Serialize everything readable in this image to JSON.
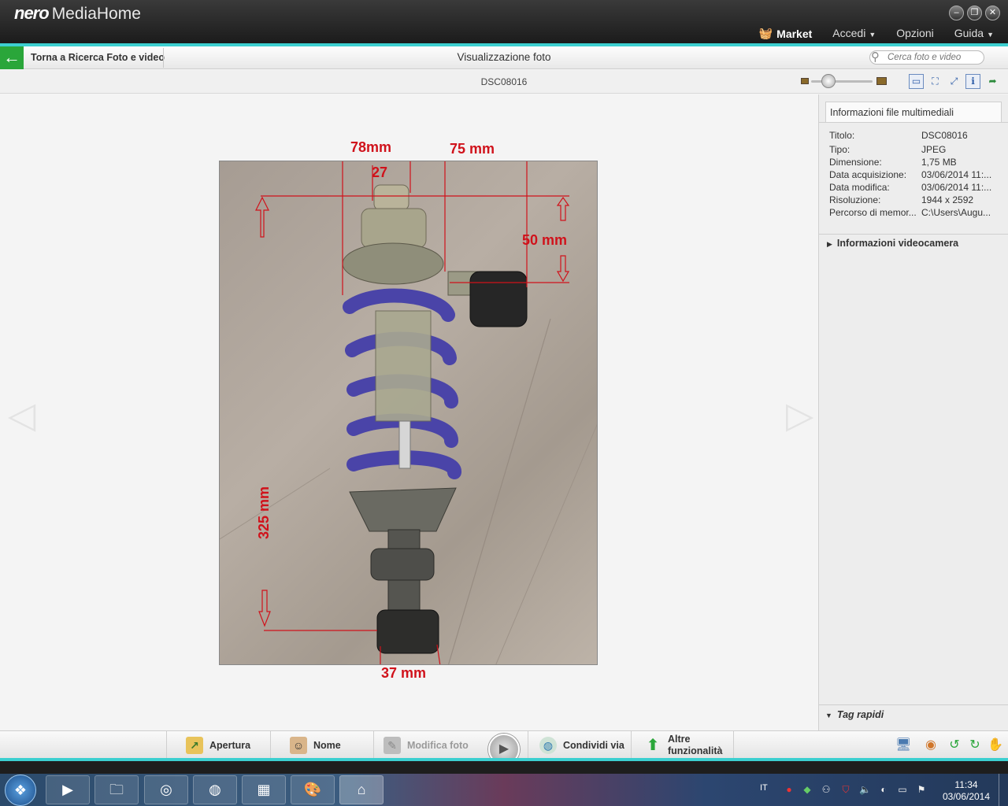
{
  "window": {
    "brand_logo": "nero",
    "brand_name": "MediaHome",
    "controls": {
      "minimize": "–",
      "restore": "❐",
      "close": "✕"
    }
  },
  "top_menu": {
    "market": "Market",
    "accedi": "Accedi",
    "opzioni": "Opzioni",
    "guida": "Guida"
  },
  "nav": {
    "back_label": "Torna a Ricerca Foto e video",
    "page_title": "Visualizzazione foto",
    "search_placeholder": "Cerca foto e video"
  },
  "viewer": {
    "filename": "DSC08016",
    "annotations": {
      "top_left": "78mm",
      "top_right": "75 mm",
      "top_small": "27",
      "side": "50 mm",
      "length": "325 mm",
      "bottom": "37 mm"
    },
    "zoom": 0.2
  },
  "info_panel": {
    "tab_label": "Informazioni file multimediali",
    "rows": [
      {
        "key": "Titolo:",
        "value": "DSC08016"
      },
      {
        "key": "Tipo:",
        "value": "JPEG"
      },
      {
        "key": "Dimensione:",
        "value": "1,75 MB"
      },
      {
        "key": "Data acquisizione:",
        "value": "03/06/2014 11:..."
      },
      {
        "key": "Data modifica:",
        "value": "03/06/2014 11:..."
      },
      {
        "key": "Risoluzione:",
        "value": "1944 x 2592"
      },
      {
        "key": "Percorso di memor...",
        "value": "C:\\Users\\Augu..."
      }
    ],
    "video_section": "Informazioni videocamera",
    "tags_section": "Tag rapidi"
  },
  "actions": {
    "apertura": "Apertura",
    "nome": "Nome",
    "modifica": "Modifica foto",
    "condividi": "Condividi via",
    "altre_1": "Altre",
    "altre_2": "funzionalità"
  },
  "taskbar": {
    "lang": "IT",
    "time": "11:34",
    "date": "03/06/2014"
  },
  "colors": {
    "accent_teal": "#3ccfd0",
    "back_green": "#2aa63a",
    "annotation_red": "#d0121b"
  }
}
